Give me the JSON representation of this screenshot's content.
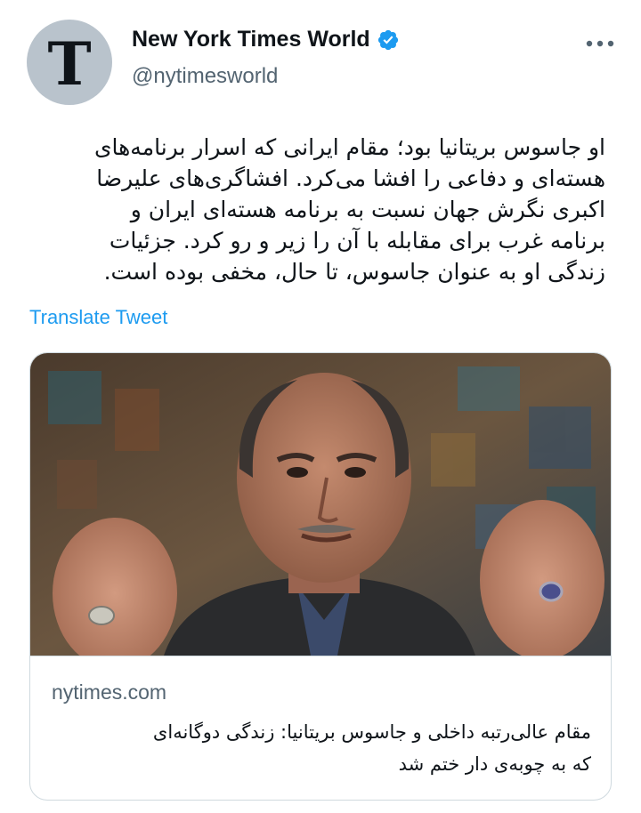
{
  "account": {
    "display_name": "New York Times World",
    "handle": "@nytimesworld",
    "avatar_letter": "T",
    "verified_icon": "verified-badge-icon",
    "more_icon": "more-horizontal-icon"
  },
  "tweet": {
    "text": "او جاسوس بریتانیا بود؛ مقام ایرانی که اسرار برنامه‌های\nهسته‌ای و دفاعی را افشا می‌کرد. افشاگری‌های علیرضا\nاکبری نگرش جهان نسبت به برنامه هسته‌ای ایران و\nبرنامه غرب  برای مقابله با آن را زیر و رو کرد. جزئیات\nزندگی او به عنوان جاسوس، تا حال، مخفی بوده است.",
    "translate_label": "Translate Tweet"
  },
  "card": {
    "domain": "nytimes.com",
    "title": "مقام عالی‌رتبه داخلی و جاسوس بریتانیا: زندگی دوگانه‌ای\nکه به چوبه‌ی دار ختم شد"
  },
  "colors": {
    "accent": "#1d9bf0",
    "text_primary": "#0f1419",
    "text_secondary": "#536471",
    "border": "#cfd9de",
    "avatar_bg": "#b9c3cc"
  }
}
